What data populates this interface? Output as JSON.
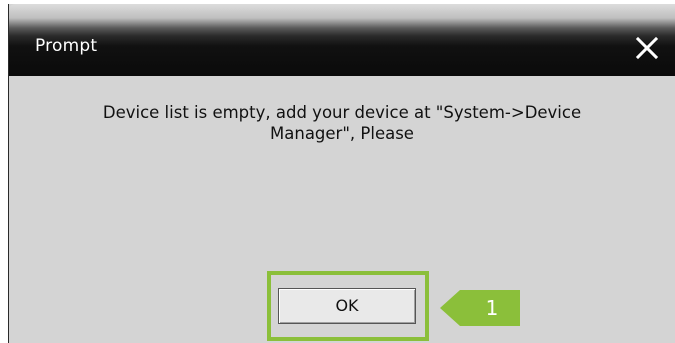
{
  "dialog": {
    "title": "Prompt",
    "close_icon": "close-icon",
    "message_line1": "Device list is empty, add your device at \"System->Device",
    "message_line2": "Manager\", Please",
    "ok_label": "OK"
  },
  "annotation": {
    "step_number": "1",
    "highlight_color": "#8bbf3a"
  }
}
